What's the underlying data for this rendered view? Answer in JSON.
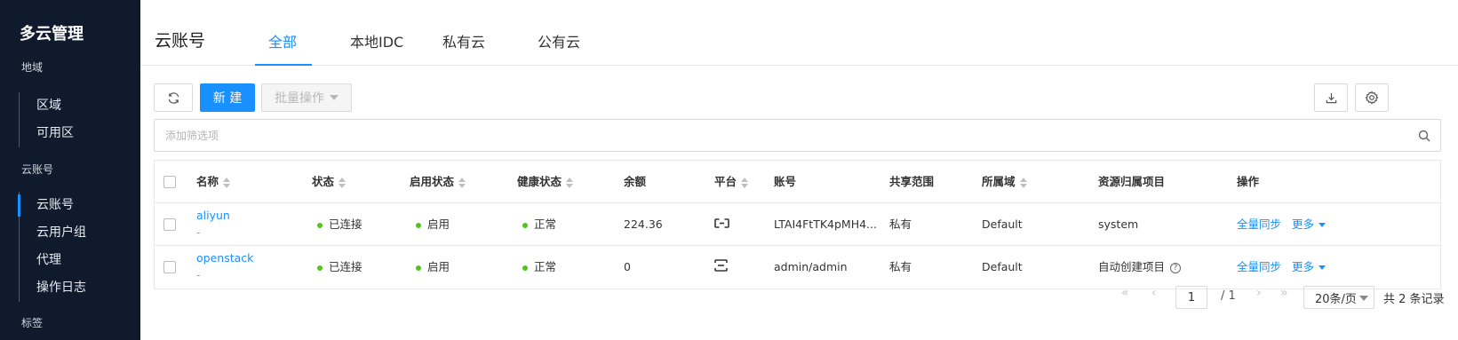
{
  "sidebar": {
    "title": "多云管理",
    "groups": [
      {
        "label": "地域",
        "items": [
          {
            "label": "区域"
          },
          {
            "label": "可用区"
          }
        ]
      },
      {
        "label": "云账号",
        "items": [
          {
            "label": "云账号"
          },
          {
            "label": "云用户组"
          },
          {
            "label": "代理"
          },
          {
            "label": "操作日志"
          }
        ]
      },
      {
        "label": "标签"
      }
    ]
  },
  "header": {
    "title": "云账号",
    "tabs": [
      {
        "label": "全部"
      },
      {
        "label": "本地IDC"
      },
      {
        "label": "私有云"
      },
      {
        "label": "公有云"
      }
    ]
  },
  "toolbar": {
    "new_label": "新 建",
    "batch_label": "批量操作"
  },
  "search": {
    "placeholder": "添加筛选项"
  },
  "table": {
    "columns": [
      "名称",
      "状态",
      "启用状态",
      "健康状态",
      "余额",
      "平台",
      "账号",
      "共享范围",
      "所属域",
      "资源归属项目",
      "操作"
    ],
    "rows": [
      {
        "name": "aliyun",
        "sub": "-",
        "status": "已连接",
        "enabled": "启用",
        "health": "正常",
        "balance": "224.36",
        "platform_icon": "aliyun-icon",
        "account": "LTAI4FtTK4pMH4...",
        "share": "私有",
        "domain": "Default",
        "project": "system",
        "action_sync": "全量同步",
        "action_more": "更多"
      },
      {
        "name": "openstack",
        "sub": "-",
        "status": "已连接",
        "enabled": "启用",
        "health": "正常",
        "balance": "0",
        "platform_icon": "openstack-icon",
        "account": "admin/admin",
        "share": "私有",
        "domain": "Default",
        "project": "自动创建项目",
        "action_sync": "全量同步",
        "action_more": "更多"
      }
    ]
  },
  "pagination": {
    "current": "1",
    "total_pages": "/ 1",
    "page_size": "20条/页",
    "summary": "共 2 条记录"
  },
  "colors": {
    "primary": "#1890ff",
    "sidebar_bg": "#0f1b2d",
    "success": "#52c41a"
  }
}
